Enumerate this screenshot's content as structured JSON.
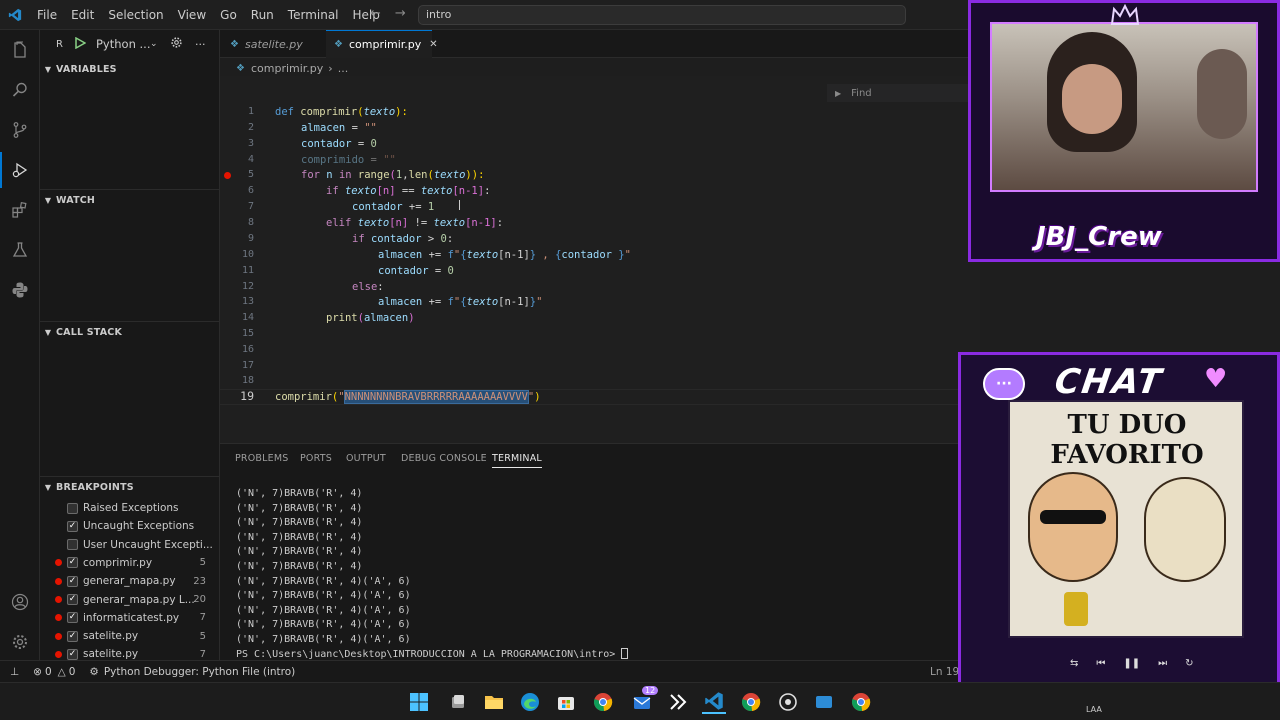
{
  "menu": [
    "File",
    "Edit",
    "Selection",
    "View",
    "Go",
    "Run",
    "Terminal",
    "Help"
  ],
  "command_center": "intro",
  "run": {
    "letter": "R",
    "config": "Python ..."
  },
  "sidebar": {
    "variables": "VARIABLES",
    "watch": "WATCH",
    "call_stack": "CALL STACK",
    "breakpoints": "BREAKPOINTS",
    "breakpoint_items": [
      {
        "label": "Raised Exceptions",
        "checked": false,
        "dot": false,
        "num": ""
      },
      {
        "label": "Uncaught Exceptions",
        "checked": true,
        "dot": false,
        "num": ""
      },
      {
        "label": "User Uncaught Excepti...",
        "checked": false,
        "dot": false,
        "num": ""
      },
      {
        "label": "comprimir.py",
        "checked": true,
        "dot": true,
        "num": "5"
      },
      {
        "label": "generar_mapa.py",
        "checked": true,
        "dot": true,
        "num": "23"
      },
      {
        "label": "generar_mapa.py    L...",
        "checked": true,
        "dot": true,
        "num": "20"
      },
      {
        "label": "informaticatest.py",
        "checked": true,
        "dot": true,
        "num": "7"
      },
      {
        "label": "satelite.py",
        "checked": true,
        "dot": true,
        "num": "5"
      },
      {
        "label": "satelite.py",
        "checked": true,
        "dot": true,
        "num": "7"
      }
    ]
  },
  "tabs": [
    {
      "label": "satelite.py",
      "active": false
    },
    {
      "label": "comprimir.py",
      "active": true
    }
  ],
  "breadcrumb": {
    "file": "comprimir.py",
    "more": "..."
  },
  "editor": {
    "line_numbers": [
      "1",
      "2",
      "3",
      "4",
      "5",
      "6",
      "7",
      "8",
      "9",
      "10",
      "11",
      "12",
      "13",
      "14",
      "15",
      "16",
      "17",
      "18",
      "19"
    ],
    "current_line": "19",
    "l1": {
      "kw": "def",
      "fn": "comprimir",
      "p1": "(",
      "param": "texto",
      "p2": "):"
    },
    "l2": {
      "var": "almacen",
      "eq": " = ",
      "str": "\"\""
    },
    "l3": {
      "var": "contador",
      "eq": " = ",
      "num": "0"
    },
    "l4": {
      "var": "comprimido",
      "eq": " = ",
      "str": "\"\""
    },
    "l5": {
      "kw1": "for",
      "var": " n ",
      "kw2": "in",
      "fn1": " range",
      "p1": "(",
      "num": "1",
      "comma": ",",
      "fn2": "len",
      "p2": "(",
      "param": "texto",
      "p3": ")):"
    },
    "l6": {
      "kw": "if",
      "param1": " texto",
      "idx1": "[n]",
      "eq": " == ",
      "param2": "texto",
      "idx2": "[n-1]",
      "colon": ":"
    },
    "l7": {
      "var": "contador",
      "op": " += ",
      "num": "1"
    },
    "l8": {
      "kw": "elif",
      "param1": " texto",
      "idx1": "[n]",
      "ne": " != ",
      "param2": "texto",
      "idx2": "[n-1]",
      "colon": ":"
    },
    "l9": {
      "kw": "if",
      "var": " contador",
      "gt": " > ",
      "num": "0",
      "colon": ":"
    },
    "l10": {
      "var": "almacen",
      "op": " += ",
      "f": "f",
      "s1": "\"",
      "b1": "{",
      "param": "texto",
      "idx": "[n-1]",
      "b2": "}",
      "s2": " , ",
      "b3": "{",
      "var2": "contador ",
      "b4": "}",
      "s3": "\""
    },
    "l11": {
      "var": "contador",
      "eq": " = ",
      "num": "0"
    },
    "l12": {
      "kw": "else",
      "colon": ":"
    },
    "l13": {
      "var": "almacen",
      "op": " += ",
      "f": "f",
      "s1": "\"",
      "b1": "{",
      "param": "texto",
      "idx": "[n-1]",
      "b2": "}",
      "s2": "\""
    },
    "l14": {
      "fn": "print",
      "p1": "(",
      "var": "almacen",
      "p2": ")"
    },
    "l19": {
      "fn": "comprimir",
      "p1": "(",
      "q1": "\"",
      "arg": "NNNNNNNNBRAVBRRRRRAAAAAAAVVVV",
      "q2": "\"",
      "p2": ")"
    }
  },
  "find": {
    "placeholder": "Find"
  },
  "panel": {
    "tabs": [
      "PROBLEMS",
      "PORTS",
      "OUTPUT",
      "DEBUG CONSOLE",
      "TERMINAL"
    ],
    "active_tab": "TERMINAL",
    "terminal_lines": [
      "('N', 7)BRAVB('R', 4)",
      "('N', 7)BRAVB('R', 4)",
      "('N', 7)BRAVB('R', 4)",
      "('N', 7)BRAVB('R', 4)",
      "('N', 7)BRAVB('R', 4)",
      "('N', 7)BRAVB('R', 4)",
      "('N', 7)BRAVB('R', 4)('A', 6)",
      "('N', 7)BRAVB('R', 4)('A', 6)",
      "('N', 7)BRAVB('R', 4)('A', 6)",
      "('N', 7)BRAVB('R', 4)('A', 6)",
      "('N', 7)BRAVB('R', 4)('A', 6)"
    ],
    "prompt": "PS C:\\Users\\juanc\\Desktop\\INTRODUCCION A LA PROGRAMACION\\intro> "
  },
  "status": {
    "errors": "0",
    "warnings": "0",
    "debugger": "Python Debugger: Python File (intro)",
    "position": "Ln 19,"
  },
  "taskbar": {
    "badge": "12"
  },
  "overlays": {
    "crew": "JBJ_Crew",
    "chat": "CHAT",
    "album_title": "TU DUO FAVORITO",
    "taskbar_user": "LAA"
  },
  "colors": {
    "accent": "#0078d4",
    "breakpoint": "#e51400",
    "overlay_purple": "#8a2be2"
  }
}
